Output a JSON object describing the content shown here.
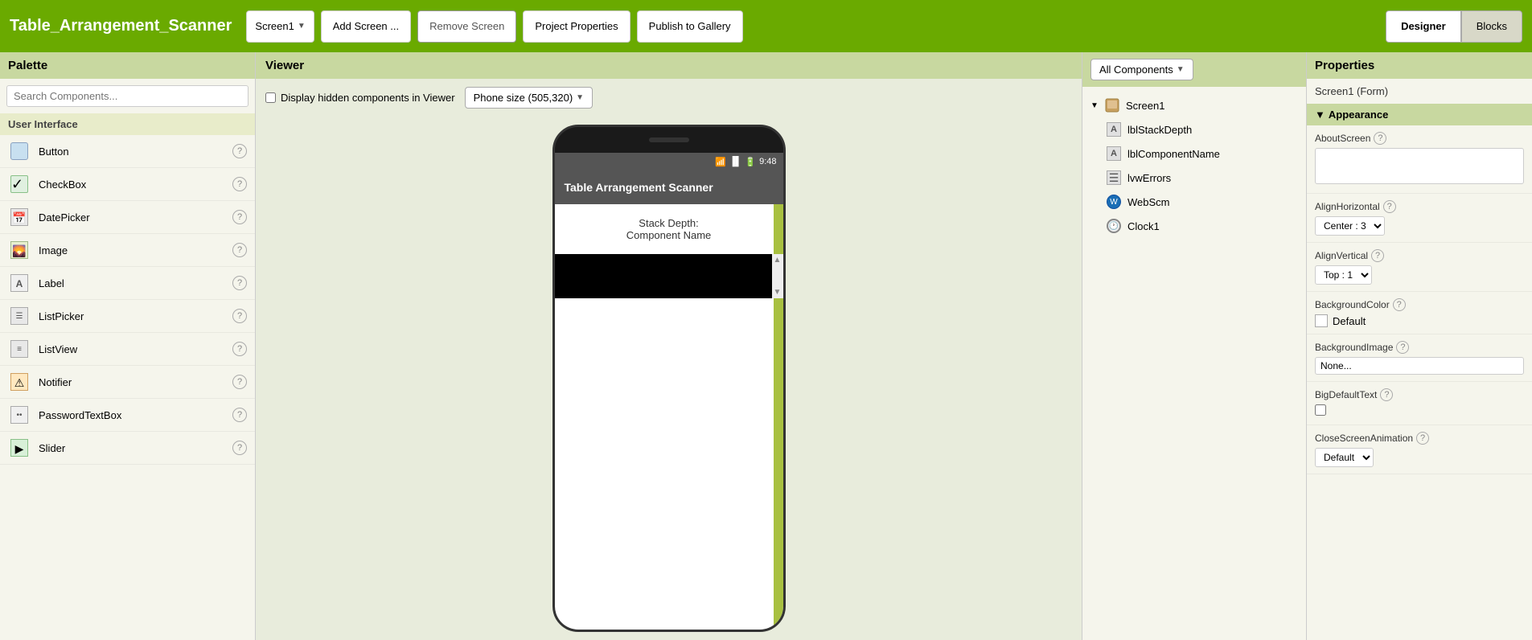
{
  "app": {
    "title": "Table_Arrangement_Scanner"
  },
  "topbar": {
    "screen_btn": "Screen1",
    "add_screen": "Add Screen ...",
    "remove_screen": "Remove Screen",
    "project_properties": "Project Properties",
    "publish_to_gallery": "Publish to Gallery",
    "designer_btn": "Designer",
    "blocks_btn": "Blocks"
  },
  "palette": {
    "header": "Palette",
    "search_placeholder": "Search Components...",
    "ui_section": "User Interface",
    "items": [
      {
        "label": "Button",
        "icon": "button"
      },
      {
        "label": "CheckBox",
        "icon": "checkbox"
      },
      {
        "label": "DatePicker",
        "icon": "datepicker"
      },
      {
        "label": "Image",
        "icon": "image"
      },
      {
        "label": "Label",
        "icon": "label"
      },
      {
        "label": "ListPicker",
        "icon": "listpicker"
      },
      {
        "label": "ListView",
        "icon": "listview"
      },
      {
        "label": "Notifier",
        "icon": "notifier"
      },
      {
        "label": "PasswordTextBox",
        "icon": "passwordtextbox"
      },
      {
        "label": "Slider",
        "icon": "slider"
      }
    ]
  },
  "viewer": {
    "header": "Viewer",
    "display_hidden_label": "Display hidden components in Viewer",
    "phone_size_label": "Phone size (505,320)",
    "app_bar_title": "Table Arrangement Scanner",
    "stack_depth_label": "Stack Depth:",
    "component_name_label": "Component Name"
  },
  "components": {
    "all_components_btn": "All Components",
    "screen1": "Screen1",
    "items": [
      {
        "label": "lblStackDepth",
        "icon": "label",
        "indent": true
      },
      {
        "label": "lblComponentName",
        "icon": "label",
        "indent": true
      },
      {
        "label": "lvwErrors",
        "icon": "listview",
        "indent": true
      },
      {
        "label": "WebScm",
        "icon": "webscm",
        "indent": true
      },
      {
        "label": "Clock1",
        "icon": "clock",
        "indent": true
      }
    ]
  },
  "properties": {
    "header": "Properties",
    "title": "Screen1 (Form)",
    "appearance_label": "Appearance",
    "about_screen_label": "AboutScreen",
    "about_screen_value": "",
    "align_horizontal_label": "AlignHorizontal",
    "align_horizontal_value": "Center : 3",
    "align_vertical_label": "AlignVertical",
    "align_vertical_value": "Top : 1",
    "background_color_label": "BackgroundColor",
    "background_color_value": "Default",
    "background_image_label": "BackgroundImage",
    "background_image_value": "None...",
    "big_default_text_label": "BigDefaultText",
    "close_screen_animation_label": "CloseScreenAnimation",
    "close_screen_animation_value": "Default"
  }
}
